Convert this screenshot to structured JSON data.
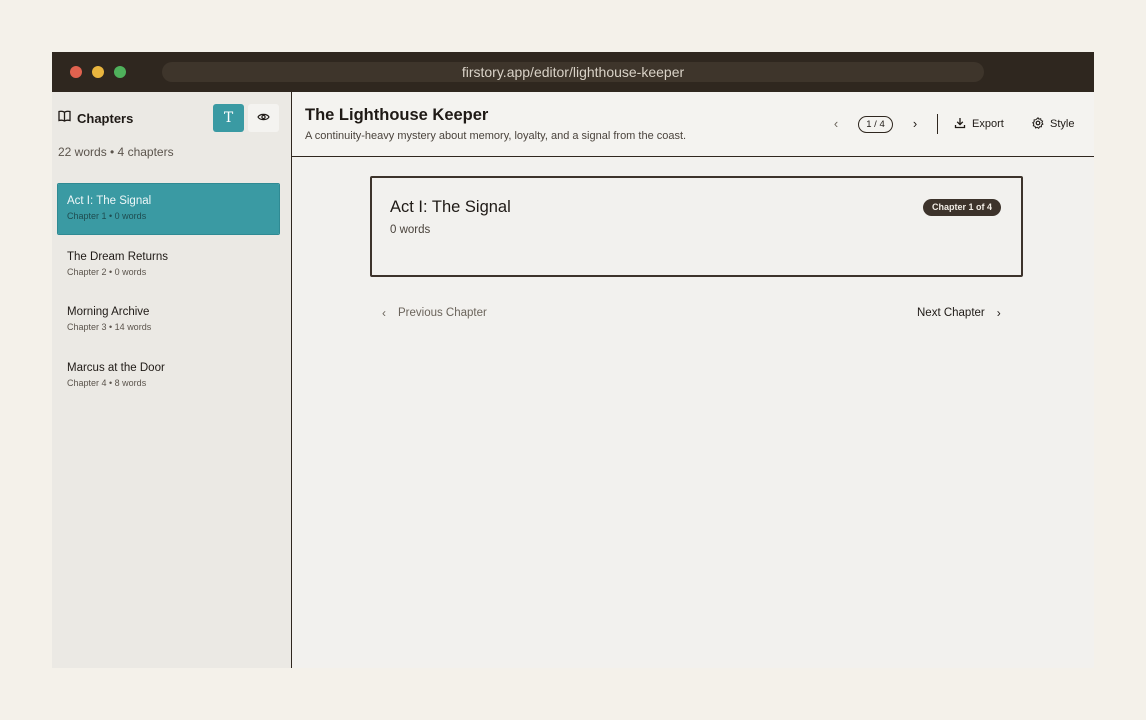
{
  "browser": {
    "url": "firstory.app/editor/lighthouse-keeper"
  },
  "sidebar": {
    "title": "Chapters",
    "icon": "book-icon",
    "modes": [
      {
        "name": "text-mode",
        "icon": "text-format-icon",
        "glyph": "T",
        "active": true
      },
      {
        "name": "preview-mode",
        "icon": "eye-icon",
        "active": false
      }
    ],
    "stats": "22 words • 4 chapters",
    "chapters": [
      {
        "title": "Act I: The Signal",
        "meta": "Chapter 1 • 0 words",
        "active": true
      },
      {
        "title": "The Dream Returns",
        "meta": "Chapter 2 • 0 words",
        "active": false
      },
      {
        "title": "Morning Archive",
        "meta": "Chapter 3 • 14 words",
        "active": false
      },
      {
        "title": "Marcus at the Door",
        "meta": "Chapter 4 • 8 words",
        "active": false
      }
    ]
  },
  "header": {
    "title": "The Lighthouse Keeper",
    "subtitle": "A continuity-heavy mystery about memory, loyalty, and a signal from the coast.",
    "page_indicator": "1 / 4",
    "export_label": "Export",
    "style_label": "Style"
  },
  "chapter_card": {
    "title": "Act I: The Signal",
    "words": "0 words",
    "badge": "Chapter 1 of 4"
  },
  "pager": {
    "prev_label": "Previous Chapter",
    "next_label": "Next Chapter"
  },
  "colors": {
    "accent": "#3a9aa3",
    "titlebar": "#2f271f",
    "page_bg": "#f4f1ea"
  }
}
